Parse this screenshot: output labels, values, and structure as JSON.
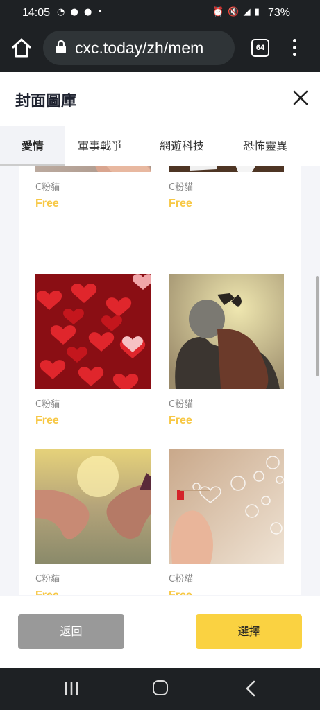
{
  "status": {
    "time": "14:05",
    "battery": "73%"
  },
  "browser": {
    "url": "cxc.today/zh/mem",
    "tab_count": "64"
  },
  "dialog": {
    "title": "封面圖庫",
    "categories": [
      "愛情",
      "軍事戰爭",
      "網遊科技",
      "恐怖靈異"
    ],
    "active_category": "愛情",
    "items": [
      {
        "author": "C粉貓",
        "price": "Free",
        "image": "hands-touching"
      },
      {
        "author": "C粉貓",
        "price": "Free",
        "image": "puzzle-heart"
      },
      {
        "author": "C粉貓",
        "price": "Free",
        "image": "red-hearts"
      },
      {
        "author": "C粉貓",
        "price": "Free",
        "image": "couple-heart-hands"
      },
      {
        "author": "C粉貓",
        "price": "Free",
        "image": "pinky-promise"
      },
      {
        "author": "C粉貓",
        "price": "Free",
        "image": "heart-bubbles"
      }
    ],
    "back_label": "返回",
    "select_label": "選擇"
  },
  "colors": {
    "accent": "#fad241",
    "price": "#f7c846",
    "back_button": "#999999",
    "chrome": "#1e2124"
  }
}
